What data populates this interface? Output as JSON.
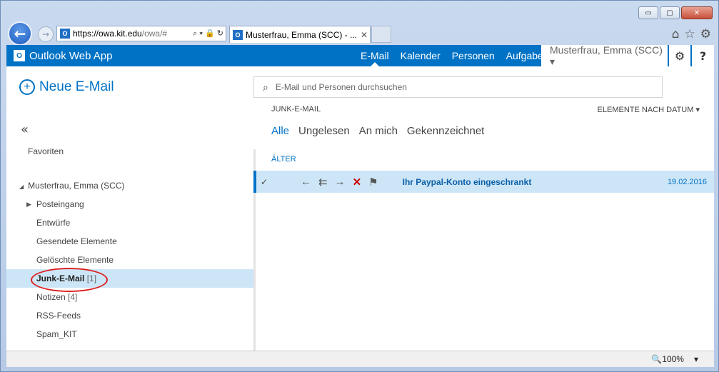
{
  "window": {
    "minimize": "▭",
    "maximize": "▢",
    "close": "✕"
  },
  "browser": {
    "back_icon": "←",
    "forward_icon": "→",
    "url_host": "https://owa.kit.edu",
    "url_rest": "/owa/#",
    "addr_tools": "⌕ ▾ 🔒 ↻",
    "tab_title": "Musterfrau, Emma (SCC) - ...",
    "tab_close": "✕",
    "icons": {
      "home": "⌂",
      "star": "☆",
      "gear": "⚙"
    }
  },
  "owa": {
    "app_name": "Outlook Web App",
    "nav": [
      "E-Mail",
      "Kalender",
      "Personen",
      "Aufgaben"
    ],
    "user": "Musterfrau, Emma (SCC) ▾",
    "gear": "⚙",
    "help": "?"
  },
  "left": {
    "new_mail": "Neue E-Mail",
    "collapse": "«",
    "favorites": "Favoriten",
    "account": "Musterfrau, Emma (SCC)",
    "folders": [
      {
        "label": "Posteingang",
        "count": ""
      },
      {
        "label": "Entwürfe",
        "count": ""
      },
      {
        "label": "Gesendete Elemente",
        "count": ""
      },
      {
        "label": "Gelöschte Elemente",
        "count": ""
      },
      {
        "label": "Junk-E-Mail",
        "count": "[1]"
      },
      {
        "label": "Notizen",
        "count": "[4]"
      },
      {
        "label": "RSS-Feeds",
        "count": ""
      },
      {
        "label": "Spam_KIT",
        "count": ""
      }
    ]
  },
  "right": {
    "search_placeholder": "E-Mail und Personen durchsuchen",
    "folder_title": "JUNK-E-MAIL",
    "sort": "ELEMENTE NACH DATUM ▾",
    "filters": [
      "Alle",
      "Ungelesen",
      "An mich",
      "Gekennzeichnet"
    ],
    "group": "ÄLTER",
    "message": {
      "check": "✓",
      "subject": "Ihr Paypal-Konto eingeschrankt",
      "date": "19.02.2016"
    }
  },
  "status": {
    "zoom": "🔍100%",
    "zoom_dropdown": "▾"
  }
}
